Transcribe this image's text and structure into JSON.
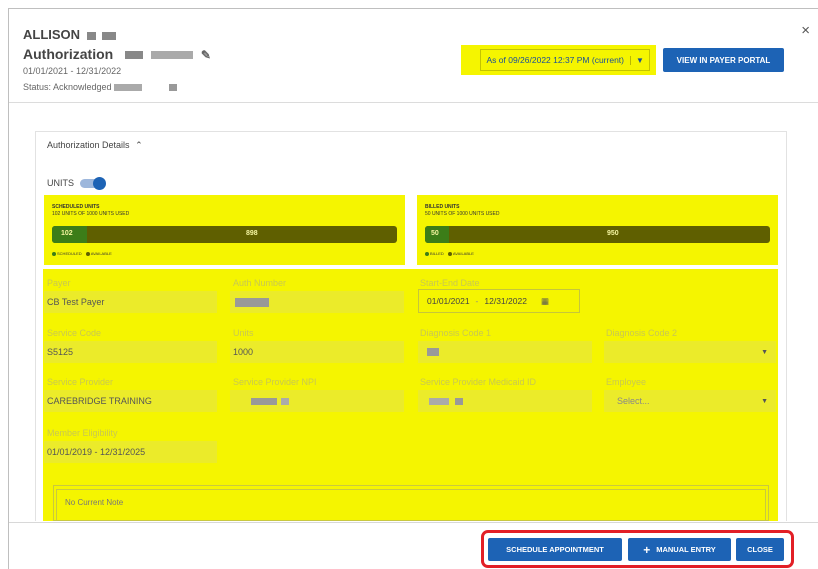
{
  "header": {
    "patient_name": "ALLISON",
    "auth_title": "Authorization",
    "date_range": "01/01/2021 - 12/31/2022",
    "status": "Status: Acknowledged",
    "as_of": "As of 09/26/2022 12:37 PM (current)",
    "view_portal_label": "VIEW IN PAYER PORTAL",
    "close_symbol": "×"
  },
  "card": {
    "title": "Authorization Details",
    "units_toggle_label": "UNITS"
  },
  "scheduled": {
    "title": "SCHEDULED UNITS",
    "subtitle": "102 UNITS OF 1000 UNITS USED",
    "used": 102,
    "available": 898,
    "used_fraction": 0.102,
    "legend_used": "SCHEDULED",
    "legend_available": "AVAILABLE"
  },
  "billed": {
    "title": "BILLED UNITS",
    "subtitle": "50 UNITS OF 1000 UNITS USED",
    "used": 50,
    "available": 950,
    "used_fraction": 0.05,
    "legend_used": "BILLED",
    "legend_available": "AVAILABLE"
  },
  "fields": {
    "payer_label": "Payer",
    "payer_value": "CB Test Payer",
    "auth_number_label": "Auth Number",
    "start_end_label": "Start-End Date",
    "start_date": "01/01/2021",
    "end_date": "12/31/2022",
    "service_code_label": "Service Code",
    "service_code_value": "S5125",
    "units_label": "Units",
    "units_value": "1000",
    "diag1_label": "Diagnosis Code 1",
    "diag2_label": "Diagnosis Code 2",
    "service_provider_label": "Service Provider",
    "service_provider_value": "CAREBRIDGE TRAINING",
    "npi_label": "Service Provider NPI",
    "medicaid_label": "Service Provider Medicaid ID",
    "employee_label": "Employee",
    "employee_placeholder": "Select...",
    "eligibility_label": "Member Eligibility",
    "eligibility_value": "01/01/2019 - 12/31/2025"
  },
  "note": {
    "text": "No Current Note"
  },
  "footer": {
    "schedule_label": "SCHEDULE APPOINTMENT",
    "manual_label": "MANUAL ENTRY",
    "close_label": "CLOSE"
  },
  "colors": {
    "highlight": "#f5f500",
    "primary": "#1d63b5",
    "annotation_red": "#e21f26",
    "bar_used": "#3c7d18",
    "bar_available": "#5f5f00"
  }
}
